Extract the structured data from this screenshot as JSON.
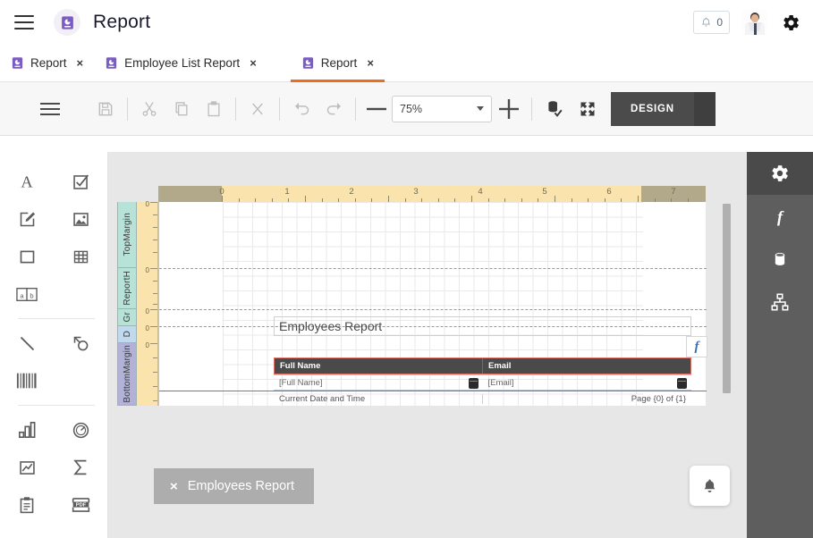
{
  "header": {
    "title": "Report",
    "menu_icon": "hamburger-icon",
    "logo_icon": "report-logo-icon",
    "notification_count": "0",
    "notification_icon": "bell-icon",
    "avatar_icon": "user-avatar",
    "settings_icon": "gear-icon"
  },
  "tabs": [
    {
      "label": "Report",
      "close": "×",
      "active": false
    },
    {
      "label": "Employee List Report",
      "close": "×",
      "active": false
    },
    {
      "label": "Report",
      "close": "×",
      "active": true
    }
  ],
  "toolbar": {
    "menu_icon": "hamburger-icon",
    "save_icon": "save-icon",
    "cut_icon": "scissors-icon",
    "copy_icon": "copy-icon",
    "paste_icon": "paste-icon",
    "delete_icon": "close-x-icon",
    "undo_icon": "undo-arrow-icon",
    "redo_icon": "redo-arrow-icon",
    "zoom_out_icon": "minus-icon",
    "zoom_in_icon": "plus-icon",
    "zoom_value": "75%",
    "preview_icon": "database-check-icon",
    "fullscreen_icon": "expand-arrows-icon",
    "design_label": "DESIGN"
  },
  "palette": {
    "groups": [
      [
        {
          "icon": "text-a-icon",
          "name": "text-tool"
        },
        {
          "icon": "checkbox-check-icon",
          "name": "checkbox-tool"
        },
        {
          "icon": "rich-text-pencil-icon",
          "name": "rich-text-tool"
        },
        {
          "icon": "image-picture-icon",
          "name": "image-tool"
        },
        {
          "icon": "rectangle-panel-icon",
          "name": "panel-tool"
        },
        {
          "icon": "table-grid-icon",
          "name": "table-tool"
        },
        {
          "icon": "ab-cell-icon",
          "name": "cross-tab-tool"
        }
      ],
      [
        {
          "icon": "diagonal-line-icon",
          "name": "line-tool"
        },
        {
          "icon": "shape-circle-icon",
          "name": "shape-tool"
        },
        {
          "icon": "barcode-icon",
          "name": "barcode-tool"
        }
      ],
      [
        {
          "icon": "bar-chart-icon",
          "name": "chart-tool"
        },
        {
          "icon": "gauge-icon",
          "name": "gauge-tool"
        },
        {
          "icon": "sparkline-icon",
          "name": "sparkline-tool"
        },
        {
          "icon": "sigma-sum-icon",
          "name": "summary-tool"
        },
        {
          "icon": "clipboard-icon",
          "name": "subreport-tool"
        },
        {
          "icon": "pdf-file-icon",
          "name": "pdf-content-tool"
        }
      ]
    ]
  },
  "canvas": {
    "ruler_h_labels": [
      "0",
      "1",
      "2",
      "3",
      "4",
      "5",
      "6",
      "7"
    ],
    "bands": [
      {
        "label": "TopMargin",
        "kind": "margin"
      },
      {
        "label": "ReportH",
        "kind": "margin"
      },
      {
        "label": "Gr",
        "kind": "margin"
      },
      {
        "label": "D",
        "kind": "detail"
      },
      {
        "label": "BottomMargin",
        "kind": "bottom"
      }
    ],
    "report_title": "Employees Report",
    "table_headers": [
      "Full Name",
      "Email"
    ],
    "detail_cells": [
      "[Full Name]",
      "[Email]"
    ],
    "footer_left": "Current Date and Time",
    "footer_right": "Page {0} of {1}",
    "fx_label": "f",
    "fx_icon": "function-fx-icon"
  },
  "status_chip": {
    "close": "×",
    "label": "Employees Report"
  },
  "bell_fab": {
    "icon": "bell-icon"
  },
  "right_dock": [
    {
      "icon": "gear-icon",
      "name": "properties-panel",
      "active": true
    },
    {
      "icon": "function-fx-icon",
      "name": "expressions-panel",
      "active": false
    },
    {
      "icon": "database-icon",
      "name": "data-panel",
      "active": false
    },
    {
      "icon": "hierarchy-icon",
      "name": "report-tree-panel",
      "active": false
    }
  ],
  "colors": {
    "accent": "#ef6c1a",
    "dock": "#5e5e5e",
    "table_header_bg": "#4a4a4a",
    "selection_border": "#e0756b",
    "ruler_yellow": "#fae3ac",
    "band_margin": "#b7e2d8",
    "band_detail": "#bfd9ef",
    "band_bottom": "#b2b2d8"
  }
}
